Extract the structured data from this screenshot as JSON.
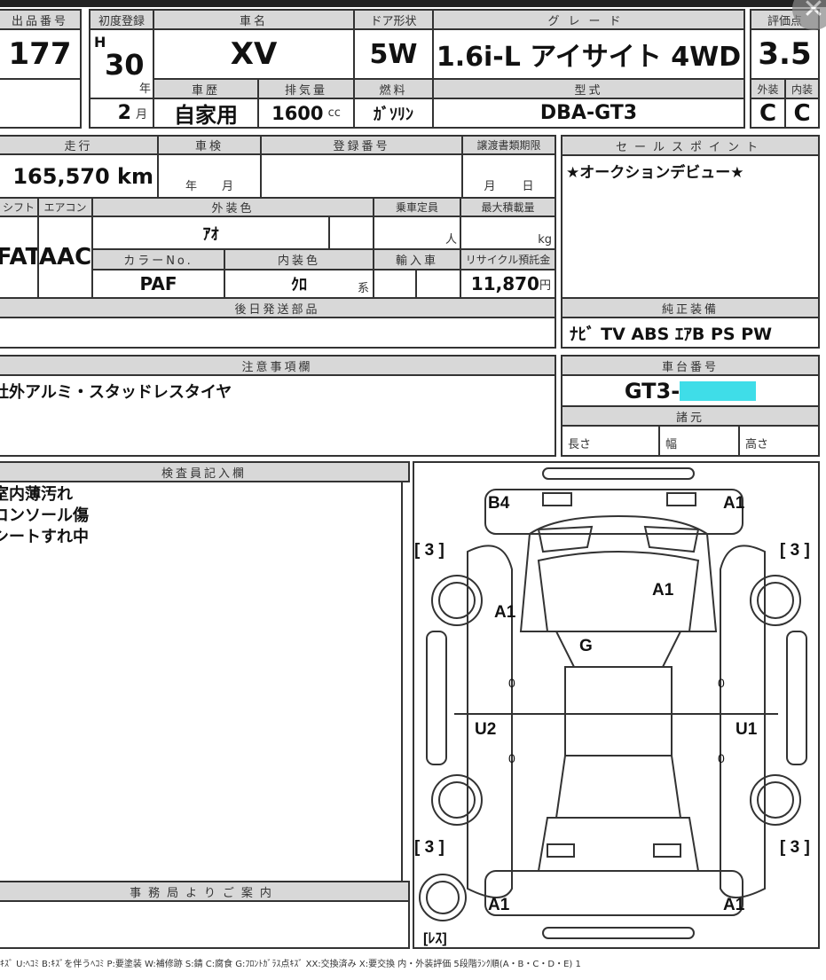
{
  "header": {
    "lot_label": "出品番号",
    "lot": "177",
    "first_reg_label": "初度登録",
    "era": "H",
    "year": "30",
    "year_unit": "年",
    "month": "2",
    "month_unit": "月",
    "name_label": "車名",
    "name": "XV",
    "door_label": "ドア形状",
    "door": "5W",
    "grade_label": "グレード",
    "grade": "1.6i-L アイサイト 4WD",
    "score_label": "評価点",
    "score": "3.5",
    "history_label": "車歴",
    "history": "自家用",
    "disp_label": "排気量",
    "disp": "1600",
    "disp_unit": "cc",
    "fuel_label": "燃料",
    "fuel": "ｶﾞｿﾘﾝ",
    "model_label": "型式",
    "model": "DBA-GT3",
    "ext_label": "外装",
    "int_label": "内装",
    "ext": "C",
    "int": "C"
  },
  "mid": {
    "mileage_label": "走行",
    "mileage": "165,570 km",
    "inspection_label": "車検",
    "insp_year": "年",
    "insp_month": "月",
    "regno_label": "登録番号",
    "transfer_label": "譲渡書類期限",
    "tr_month": "月",
    "tr_day": "日",
    "shift_label": "シフト",
    "ac_label": "エアコン",
    "color_label": "外装色",
    "capacity_label": "乗車定員",
    "load_label": "最大積載量",
    "shift": "FAT",
    "ac": "AAC",
    "color": "ｱｵ",
    "cap_unit": "人",
    "load_unit": "kg",
    "colorno_label": "カラーNo.",
    "intcolor_label": "内装色",
    "import_label": "輸入車",
    "recycle_label": "リサイクル預託金",
    "colorno": "PAF",
    "intcolor": "ｸﾛ",
    "intcolor_unit": "系",
    "recycle": "11,870",
    "recycle_unit": "円",
    "later_parts_label": "後日発送部品"
  },
  "sales": {
    "label": "セールスポイント",
    "text": "★オークションデビュー★",
    "equip_label": "純正装備",
    "equip": "ﾅﾋﾞ TV ABS ｴｱB PS PW"
  },
  "notes": {
    "label": "注意事項欄",
    "text": "社外アルミ・スタッドレスタイヤ"
  },
  "chassis": {
    "label": "車台番号",
    "value": "GT3-",
    "spec_label": "諸元",
    "length": "長さ",
    "width": "幅",
    "height": "高さ"
  },
  "inspector": {
    "label": "検査員記入欄",
    "lines": [
      "室内薄汚れ",
      "コンソール傷",
      "シートすれ中"
    ]
  },
  "office": {
    "label": "事務局よりご案内"
  },
  "diagram": {
    "marks": [
      "B4",
      "A1",
      "[ 3 ]",
      "[ 3 ]",
      "A1",
      "A1",
      "G",
      "0",
      "0",
      "U2",
      "U1",
      "0",
      "0",
      "[ 3 ]",
      "[ 3 ]",
      "A1",
      "A1",
      "[ﾚｽ]"
    ]
  },
  "legend": "ｷｽﾞ U:ﾍｺﾐ B:ｷｽﾞを伴うﾍｺﾐ P:要塗装 W:補修跡 S:錆 C:腐食 G:ﾌﾛﾝﾄｶﾞﾗｽ点ｷｽﾞ XX:交換済み X:要交換 内・外装評価 5段階ﾗﾝｸ順(A・B・C・D・E) 1"
}
